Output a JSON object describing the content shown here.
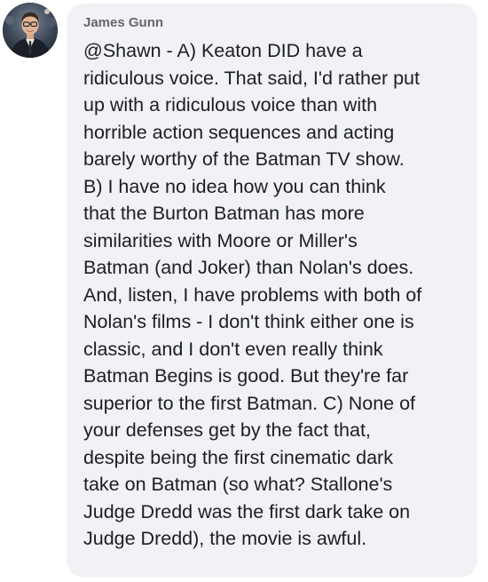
{
  "comment": {
    "author_name": "James Gunn",
    "avatar_icon": "profile-photo-icon",
    "text": "@Shawn - A) Keaton DID have a\nridiculous voice. That said, I'd rather put\nup with a ridiculous voice than with\nhorrible action sequences and acting\nbarely worthy of the Batman TV show.\nB) I have no idea how you can think\nthat the Burton Batman has more\nsimilarities with Moore or Miller's\nBatman (and Joker) than Nolan's does.\nAnd, listen, I have problems with both of\nNolan's films - I don't think either one is\nclassic, and I don't even really think\nBatman Begins is good.  But they're far\nsuperior to the first Batman. C) None of\nyour defenses get by the fact that,\ndespite being the first cinematic dark\ntake on Batman (so what? Stallone's\nJudge Dredd was the first dark take on\nJudge Dredd), the movie is awful."
  },
  "colors": {
    "bubble_background": "#f0f2f5",
    "author_text": "#65676b",
    "body_text": "#1c1e21"
  }
}
